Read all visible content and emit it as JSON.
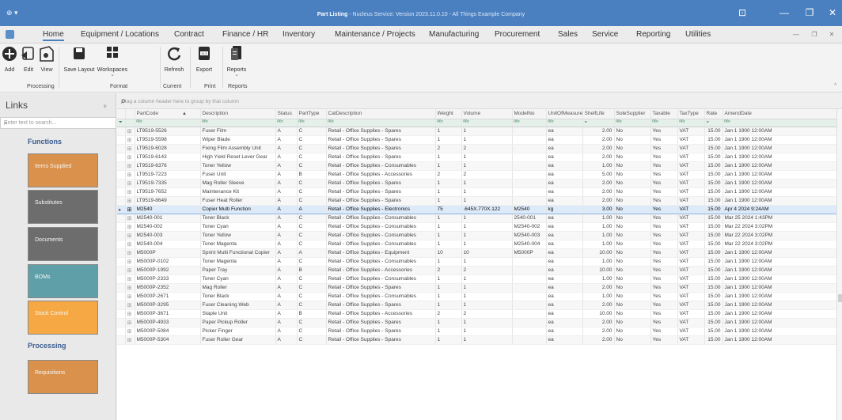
{
  "window": {
    "title_app": "Part Listing",
    "title_rest": " - Nucleus Service: Version 2023.11.0.10 - All Things Example Company",
    "left_glyph": "⊕ ▾",
    "controls": [
      "⊡",
      "—",
      "❐",
      "✕"
    ]
  },
  "menu": {
    "items": [
      "Home",
      "Equipment / Locations",
      "Contract",
      "Finance / HR",
      "Inventory",
      "Maintenance / Projects",
      "Manufacturing",
      "Procurement",
      "Sales",
      "Service",
      "Reporting",
      "Utilities"
    ],
    "active": "Home",
    "mdi_controls": [
      "—",
      "❐",
      "✕"
    ]
  },
  "ribbon": {
    "buttons": [
      {
        "label": "Add",
        "icon": "add-icon"
      },
      {
        "label": "Edit",
        "icon": "edit-icon"
      },
      {
        "label": "View",
        "icon": "view-icon"
      },
      {
        "label": "Save Layout",
        "icon": "save-layout-icon"
      },
      {
        "label": "Workspaces",
        "icon": "workspaces-icon"
      },
      {
        "label": "Refresh",
        "icon": "refresh-icon"
      },
      {
        "label": "Export",
        "icon": "export-icon"
      },
      {
        "label": "Reports",
        "icon": "reports-icon"
      }
    ],
    "groups": [
      "Processing",
      "Format",
      "Current",
      "Print",
      "Reports"
    ],
    "collapse_glyph": "^"
  },
  "links": {
    "title": "Links",
    "pin_glyph": "ᵩ",
    "search_placeholder": "Enter text to search...",
    "sections": [
      {
        "title": "Functions"
      },
      {
        "title": "Processing"
      }
    ],
    "tiles": [
      {
        "label": "Items Supplied",
        "color": "#d9914b"
      },
      {
        "label": "Substitutes",
        "color": "#6d6d6d"
      },
      {
        "label": "Documents",
        "color": "#6d6d6d"
      },
      {
        "label": "BOMs",
        "color": "#5f9fa8"
      },
      {
        "label": "Stock Control",
        "color": "#f5a843"
      },
      {
        "label": "Requisitions",
        "color": "#d9914b"
      }
    ]
  },
  "grid": {
    "group_hint": "Drag a column header here to group by that column",
    "columns": [
      "PartCode",
      "Description",
      "Status",
      "PartType",
      "CatDescription",
      "Weight",
      "Volume",
      "ModelNo",
      "UnitOfMeasure",
      "ShelfLife",
      "SoleSupplier",
      "Taxable",
      "TaxType",
      "Rate",
      "AmendDate"
    ],
    "sort_glyph": "▲",
    "filter_glyphs": [
      "ᴿᴮᶜ",
      "=",
      "▾"
    ],
    "selected_index": 10,
    "rows": [
      [
        "LT9519-5526",
        "Fuser Film",
        "A",
        "C",
        "Retail - Office Supplies - Spares",
        "1",
        "1",
        "",
        "ea",
        "2.00",
        "No",
        "Yes",
        "VAT",
        "15.00",
        "Jan 1 1900 12:00AM"
      ],
      [
        "LT9519-5598",
        "Wiper Blade",
        "A",
        "C",
        "Retail - Office Supplies - Spares",
        "1",
        "1",
        "",
        "ea",
        "2.00",
        "No",
        "Yes",
        "VAT",
        "15.00",
        "Jan 1 1900 12:00AM"
      ],
      [
        "LT9519-6028",
        "Fixing Film Assembly Unit",
        "A",
        "C",
        "Retail - Office Supplies - Spares",
        "2",
        "2",
        "",
        "ea",
        "2.00",
        "No",
        "Yes",
        "VAT",
        "15.00",
        "Jan 1 1900 12:00AM"
      ],
      [
        "LT9519-6143",
        "High Yield Reset Lever Gear",
        "A",
        "C",
        "Retail - Office Supplies - Spares",
        "1",
        "1",
        "",
        "ea",
        "2.00",
        "No",
        "Yes",
        "VAT",
        "15.00",
        "Jan 1 1900 12:00AM"
      ],
      [
        "LT9519-6376",
        "Toner Yellow",
        "A",
        "C",
        "Retail - Office Supplies - Consumables",
        "1",
        "1",
        "",
        "ea",
        "1.00",
        "No",
        "Yes",
        "VAT",
        "15.00",
        "Jan 1 1900 12:00AM"
      ],
      [
        "LT9519-7223",
        "Fuser Unit",
        "A",
        "B",
        "Retail - Office Supplies - Accessories",
        "2",
        "2",
        "",
        "ea",
        "5.00",
        "No",
        "Yes",
        "VAT",
        "15.00",
        "Jan 1 1900 12:00AM"
      ],
      [
        "LT9519-7335",
        "Mag Roller Sleeve",
        "A",
        "C",
        "Retail - Office Supplies - Spares",
        "1",
        "1",
        "",
        "ea",
        "2.00",
        "No",
        "Yes",
        "VAT",
        "15.00",
        "Jan 1 1900 12:00AM"
      ],
      [
        "LT9519-7652",
        "Maintenance Kit",
        "A",
        "C",
        "Retail - Office Supplies - Spares",
        "1",
        "1",
        "",
        "ea",
        "2.00",
        "No",
        "Yes",
        "VAT",
        "15.00",
        "Jan 1 1900 12:00AM"
      ],
      [
        "LT9519-8649",
        "Fuser Heat Roller",
        "A",
        "C",
        "Retail - Office Supplies - Spares",
        "1",
        "1",
        "",
        "ea",
        "2.00",
        "No",
        "Yes",
        "VAT",
        "15.00",
        "Jan 1 1900 12:00AM"
      ],
      [
        "M2540",
        "Copier Multi Function",
        "A",
        "A",
        "Retail - Office Supplies - Electronics",
        "75",
        ".645X.770X.122",
        "M2540",
        "kg",
        "3.00",
        "No",
        "Yes",
        "VAT",
        "15.00",
        "Apr 4 2024 9:24AM"
      ],
      [
        "M2540-001",
        "Toner Black",
        "A",
        "C",
        "Retail - Office Supplies - Consumables",
        "1",
        "1",
        "2540-001",
        "ea",
        "1.00",
        "No",
        "Yes",
        "VAT",
        "15.00",
        "Mar 25 2024 1:43PM"
      ],
      [
        "M2540-002",
        "Toner Cyan",
        "A",
        "C",
        "Retail - Office Supplies - Consumables",
        "1",
        "1",
        "M2540-002",
        "ea",
        "1.00",
        "No",
        "Yes",
        "VAT",
        "15.00",
        "Mar 22 2024 3:02PM"
      ],
      [
        "M2540-003",
        "Toner Yellow",
        "A",
        "C",
        "Retail - Office Supplies - Consumables",
        "1",
        "1",
        "M2540-003",
        "ea",
        "1.00",
        "No",
        "Yes",
        "VAT",
        "15.00",
        "Mar 22 2024 3:02PM"
      ],
      [
        "M2540-004",
        "Toner Magenta",
        "A",
        "C",
        "Retail - Office Supplies - Consumables",
        "1",
        "1",
        "M2540-004",
        "ea",
        "1.00",
        "No",
        "Yes",
        "VAT",
        "15.00",
        "Mar 22 2024 3:02PM"
      ],
      [
        "M5000P",
        "Sprint Multi Functional Copier",
        "A",
        "A",
        "Retail - Office Supplies - Equipment",
        "10",
        "10",
        "M5000P",
        "ea",
        "10.00",
        "No",
        "Yes",
        "VAT",
        "15.00",
        "Jan 1 1900 12:00AM"
      ],
      [
        "M5000P-0102",
        "Toner Magenta",
        "A",
        "C",
        "Retail - Office Supplies - Consumables",
        "1",
        "1",
        "",
        "ea",
        "1.00",
        "No",
        "Yes",
        "VAT",
        "15.00",
        "Jan 1 1900 12:00AM"
      ],
      [
        "M5000P-1992",
        "Paper Tray",
        "A",
        "B",
        "Retail - Office Supplies - Accessories",
        "2",
        "2",
        "",
        "ea",
        "10.00",
        "No",
        "Yes",
        "VAT",
        "15.00",
        "Jan 1 1900 12:00AM"
      ],
      [
        "M5000P-2333",
        "Toner Cyan",
        "A",
        "C",
        "Retail - Office Supplies - Consumables",
        "1",
        "1",
        "",
        "ea",
        "1.00",
        "No",
        "Yes",
        "VAT",
        "15.00",
        "Jan 1 1900 12:00AM"
      ],
      [
        "M5000P-2352",
        "Mag Roller",
        "A",
        "C",
        "Retail - Office Supplies - Spares",
        "1",
        "1",
        "",
        "ea",
        "2.00",
        "No",
        "Yes",
        "VAT",
        "15.00",
        "Jan 1 1900 12:00AM"
      ],
      [
        "M5000P-2671",
        "Toner Black",
        "A",
        "C",
        "Retail - Office Supplies - Consumables",
        "1",
        "1",
        "",
        "ea",
        "1.00",
        "No",
        "Yes",
        "VAT",
        "15.00",
        "Jan 1 1900 12:00AM"
      ],
      [
        "M5000P-3295",
        "Fuser Cleaning Web",
        "A",
        "C",
        "Retail - Office Supplies - Spares",
        "1",
        "1",
        "",
        "ea",
        "2.00",
        "No",
        "Yes",
        "VAT",
        "15.00",
        "Jan 1 1900 12:00AM"
      ],
      [
        "M5000P-3671",
        "Staple Unit",
        "A",
        "B",
        "Retail - Office Supplies - Accessories",
        "2",
        "2",
        "",
        "ea",
        "10.00",
        "No",
        "Yes",
        "VAT",
        "15.00",
        "Jan 1 1900 12:00AM"
      ],
      [
        "M5000P-4933",
        "Paper Pickup Roller",
        "A",
        "C",
        "Retail - Office Supplies - Spares",
        "1",
        "1",
        "",
        "ea",
        "2.00",
        "No",
        "Yes",
        "VAT",
        "15.00",
        "Jan 1 1900 12:00AM"
      ],
      [
        "M5000P-5084",
        "Picker Finger",
        "A",
        "C",
        "Retail - Office Supplies - Spares",
        "1",
        "1",
        "",
        "ea",
        "2.00",
        "No",
        "Yes",
        "VAT",
        "15.00",
        "Jan 1 1900 12:00AM"
      ],
      [
        "M5000P-5304",
        "Fuser Roller Gear",
        "A",
        "C",
        "Retail - Office Supplies - Spares",
        "1",
        "1",
        "",
        "ea",
        "2.00",
        "No",
        "Yes",
        "VAT",
        "15.00",
        "Jan 1 1900 12:00AM"
      ]
    ]
  }
}
